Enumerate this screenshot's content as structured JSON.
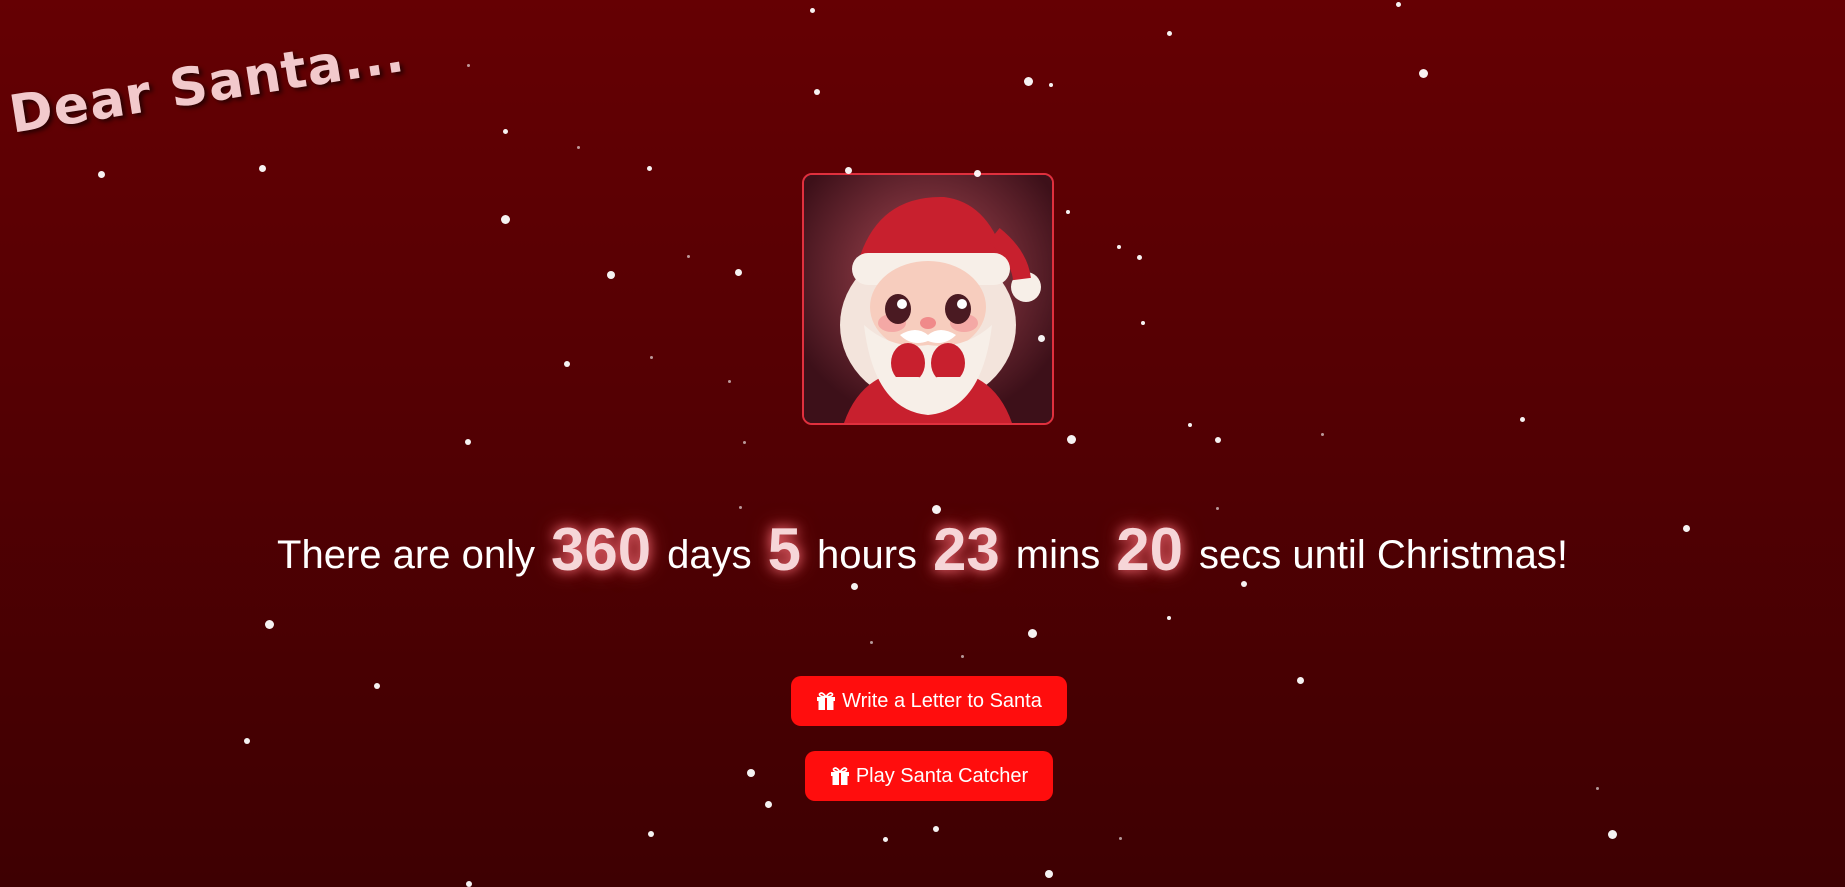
{
  "header": {
    "logo_text": "Dear Santa..."
  },
  "hero": {
    "image_alt": "Santa Claus illustration"
  },
  "countdown": {
    "prefix": "There are only",
    "days_value": "360",
    "days_label": "days",
    "hours_value": "5",
    "hours_label": "hours",
    "mins_value": "23",
    "mins_label": "mins",
    "secs_value": "20",
    "suffix": "secs until Christmas!"
  },
  "actions": {
    "letter_button_label": "Write a Letter to Santa",
    "game_button_label": "Play Santa Catcher",
    "button_icon": "gift-icon"
  },
  "colors": {
    "background_top": "#650003",
    "background_bottom": "#3e0002",
    "button": "#ff0d0d",
    "logo": "#f2c9cc",
    "frame_border": "#e0303e"
  }
}
